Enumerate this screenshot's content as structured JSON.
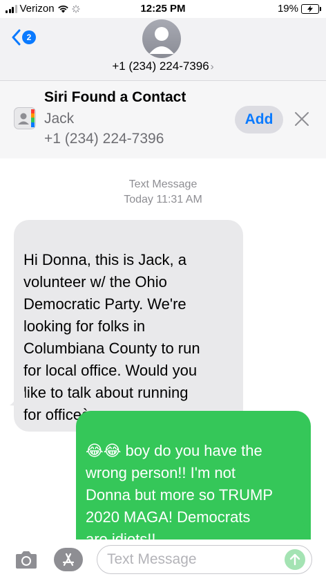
{
  "status_bar": {
    "carrier": "Verizon",
    "time": "12:25 PM",
    "battery_percent": "19%"
  },
  "header": {
    "back_badge_count": "2",
    "contact_number": "+1 (234) 224-7396"
  },
  "siri_banner": {
    "title": "Siri Found a Contact",
    "name": "Jack",
    "phone": "+1 (234) 224-7396",
    "add_label": "Add"
  },
  "conversation": {
    "service_label": "Text Message",
    "timestamp": "Today 11:31 AM",
    "messages": [
      {
        "direction": "received",
        "text": "Hi Donna, this is Jack, a\nvolunteer w/ the Ohio\nDemocratic Party. We're\nlooking for folks in\nColumbiana County to run\nfor local office. Would you\nlike to talk about running\nfor officeà"
      },
      {
        "direction": "sent",
        "emoji_prefix": "😂😂",
        "text": "boy do you have the\nwrong person!!  I'm not\nDonna but more so TRUMP\n2020 MAGA!  Democrats\nare idiots!!"
      }
    ]
  },
  "input_bar": {
    "placeholder": "Text Message"
  },
  "colors": {
    "accent": "#0a7aff",
    "sent_bubble": "#35c759",
    "received_bubble": "#e9e9eb"
  }
}
